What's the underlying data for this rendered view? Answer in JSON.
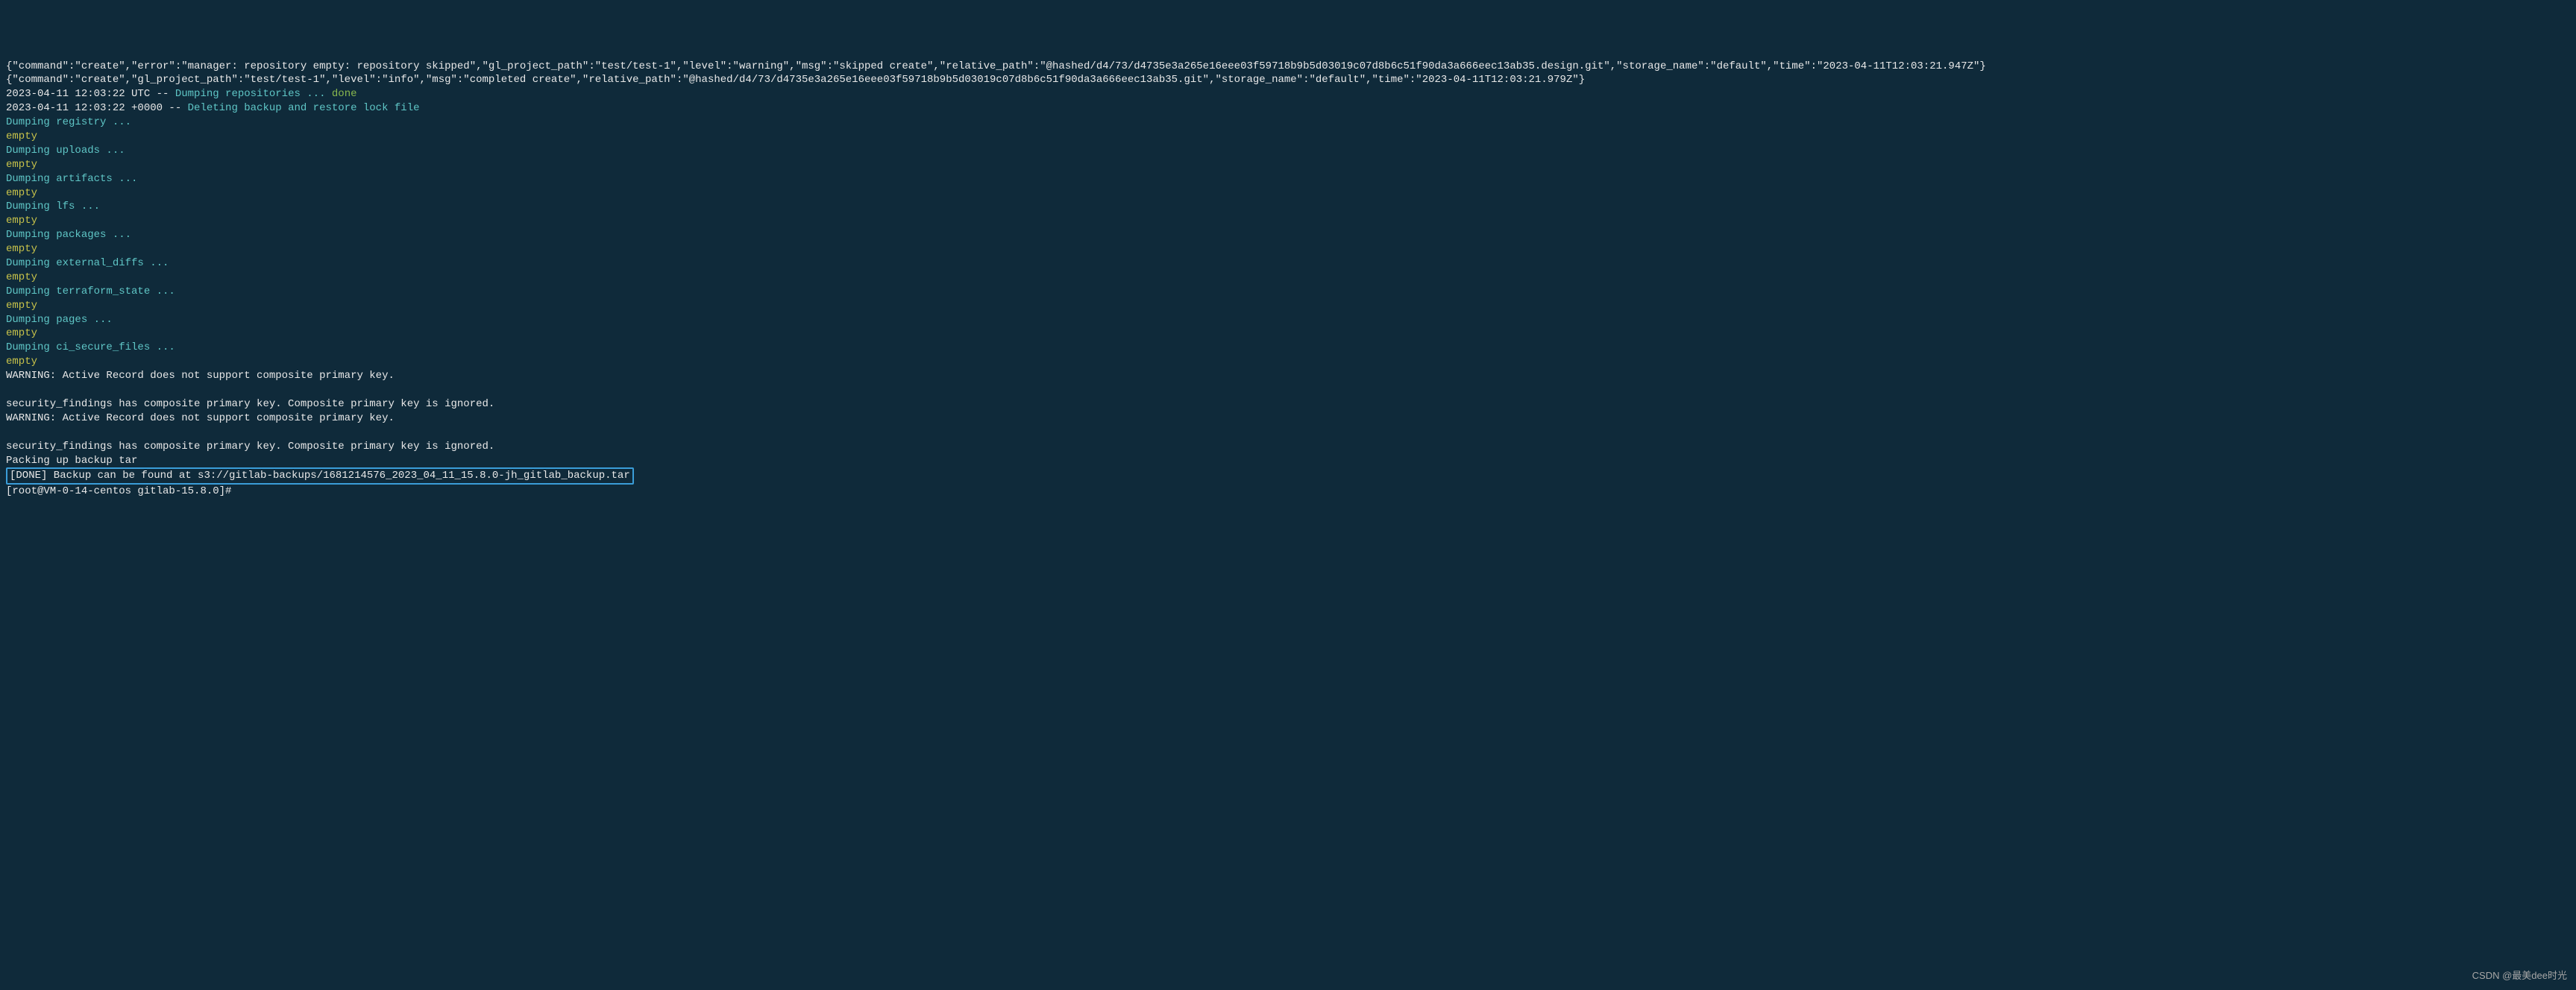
{
  "json_line_1": "{\"command\":\"create\",\"error\":\"manager: repository empty: repository skipped\",\"gl_project_path\":\"test/test-1\",\"level\":\"warning\",\"msg\":\"skipped create\",\"relative_path\":\"@hashed/d4/73/d4735e3a265e16eee03f59718b9b5d03019c07d8b6c51f90da3a666eec13ab35.design.git\",\"storage_name\":\"default\",\"time\":\"2023-04-11T12:03:21.947Z\"}",
  "json_line_2": "{\"command\":\"create\",\"gl_project_path\":\"test/test-1\",\"level\":\"info\",\"msg\":\"completed create\",\"relative_path\":\"@hashed/d4/73/d4735e3a265e16eee03f59718b9b5d03019c07d8b6c51f90da3a666eec13ab35.git\",\"storage_name\":\"default\",\"time\":\"2023-04-11T12:03:21.979Z\"}",
  "ts1_prefix": "2023-04-11 12:03:22 UTC -- ",
  "ts1_action": "Dumping repositories ... ",
  "ts1_done": "done",
  "ts2_prefix": "2023-04-11 12:03:22 +0000 -- ",
  "ts2_action": "Deleting backup and restore lock file",
  "dump_registry": "Dumping registry ...",
  "dump_uploads": "Dumping uploads ...",
  "dump_artifacts": "Dumping artifacts ...",
  "dump_lfs": "Dumping lfs ...",
  "dump_packages": "Dumping packages ...",
  "dump_external_diffs": "Dumping external_diffs ...",
  "dump_terraform_state": "Dumping terraform_state ...",
  "dump_pages": "Dumping pages ...",
  "dump_ci_secure_files": "Dumping ci_secure_files ...",
  "empty": "empty",
  "warn1": "WARNING: Active Record does not support composite primary key.",
  "blank": "",
  "warn2": "security_findings has composite primary key. Composite primary key is ignored.",
  "warn3": "WARNING: Active Record does not support composite primary key.",
  "warn4": "security_findings has composite primary key. Composite primary key is ignored.",
  "packing": "Packing up backup tar",
  "done_line": "[DONE] Backup can be found at s3://gitlab-backups/1681214576_2023_04_11_15.8.0-jh_gitlab_backup.tar",
  "prompt": "[root@VM-0-14-centos gitlab-15.8.0]#",
  "watermark": "CSDN @最美dee时光"
}
